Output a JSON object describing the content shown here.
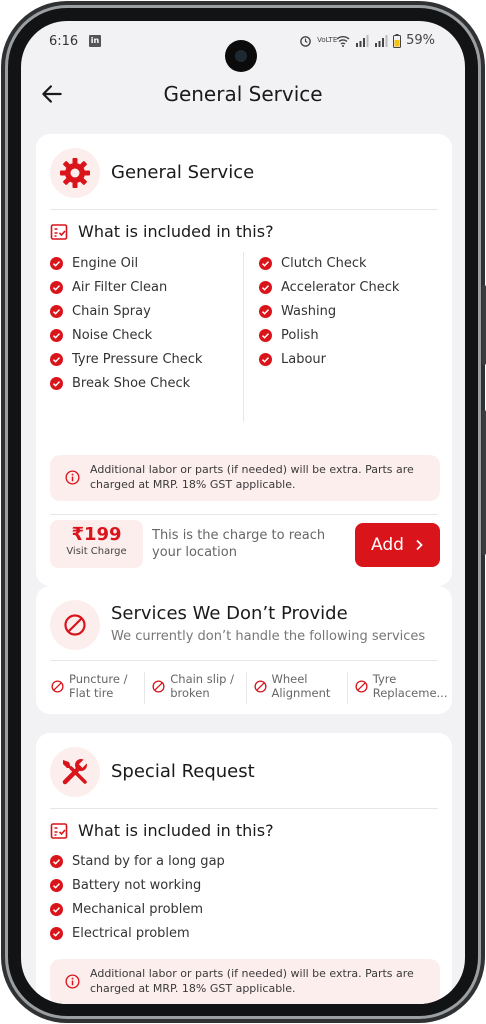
{
  "status_bar": {
    "time": "6:16",
    "linkedin_badge": "in",
    "network_label": "VoLTE",
    "battery": "59%"
  },
  "header": {
    "title": "General Service"
  },
  "general_service": {
    "title": "General Service",
    "included_heading": "What is included in this?",
    "left_items": [
      "Engine Oil",
      "Air Filter Clean",
      "Chain Spray",
      "Noise Check",
      "Tyre Pressure Check",
      "Break Shoe Check"
    ],
    "right_items": [
      "Clutch Check",
      "Accelerator Check",
      "Washing",
      "Polish",
      "Labour"
    ],
    "note": "Additional labor or parts (if needed) will be extra. Parts are charged at MRP. 18% GST applicable.",
    "price": "₹199",
    "price_label": "Visit Charge",
    "charge_text": "This is the charge to reach your location",
    "add_label": "Add"
  },
  "not_provided": {
    "title": "Services We Don’t Provide",
    "subtitle": "We currently don’t handle the following services",
    "items": [
      "Puncture / Flat tire",
      "Chain slip / broken",
      "Wheel Alignment",
      "Tyre Replaceme..."
    ]
  },
  "special_request": {
    "title": "Special Request",
    "included_heading": "What is included in this?",
    "items": [
      "Stand by for a long gap",
      "Battery not working",
      "Mechanical problem",
      "Electrical problem"
    ],
    "note": "Additional labor or parts (if needed) will be extra. Parts are charged at MRP. 18% GST applicable."
  },
  "colors": {
    "accent": "#d9141a",
    "accent_light": "#fdeeee",
    "background": "#f2f2f4"
  }
}
